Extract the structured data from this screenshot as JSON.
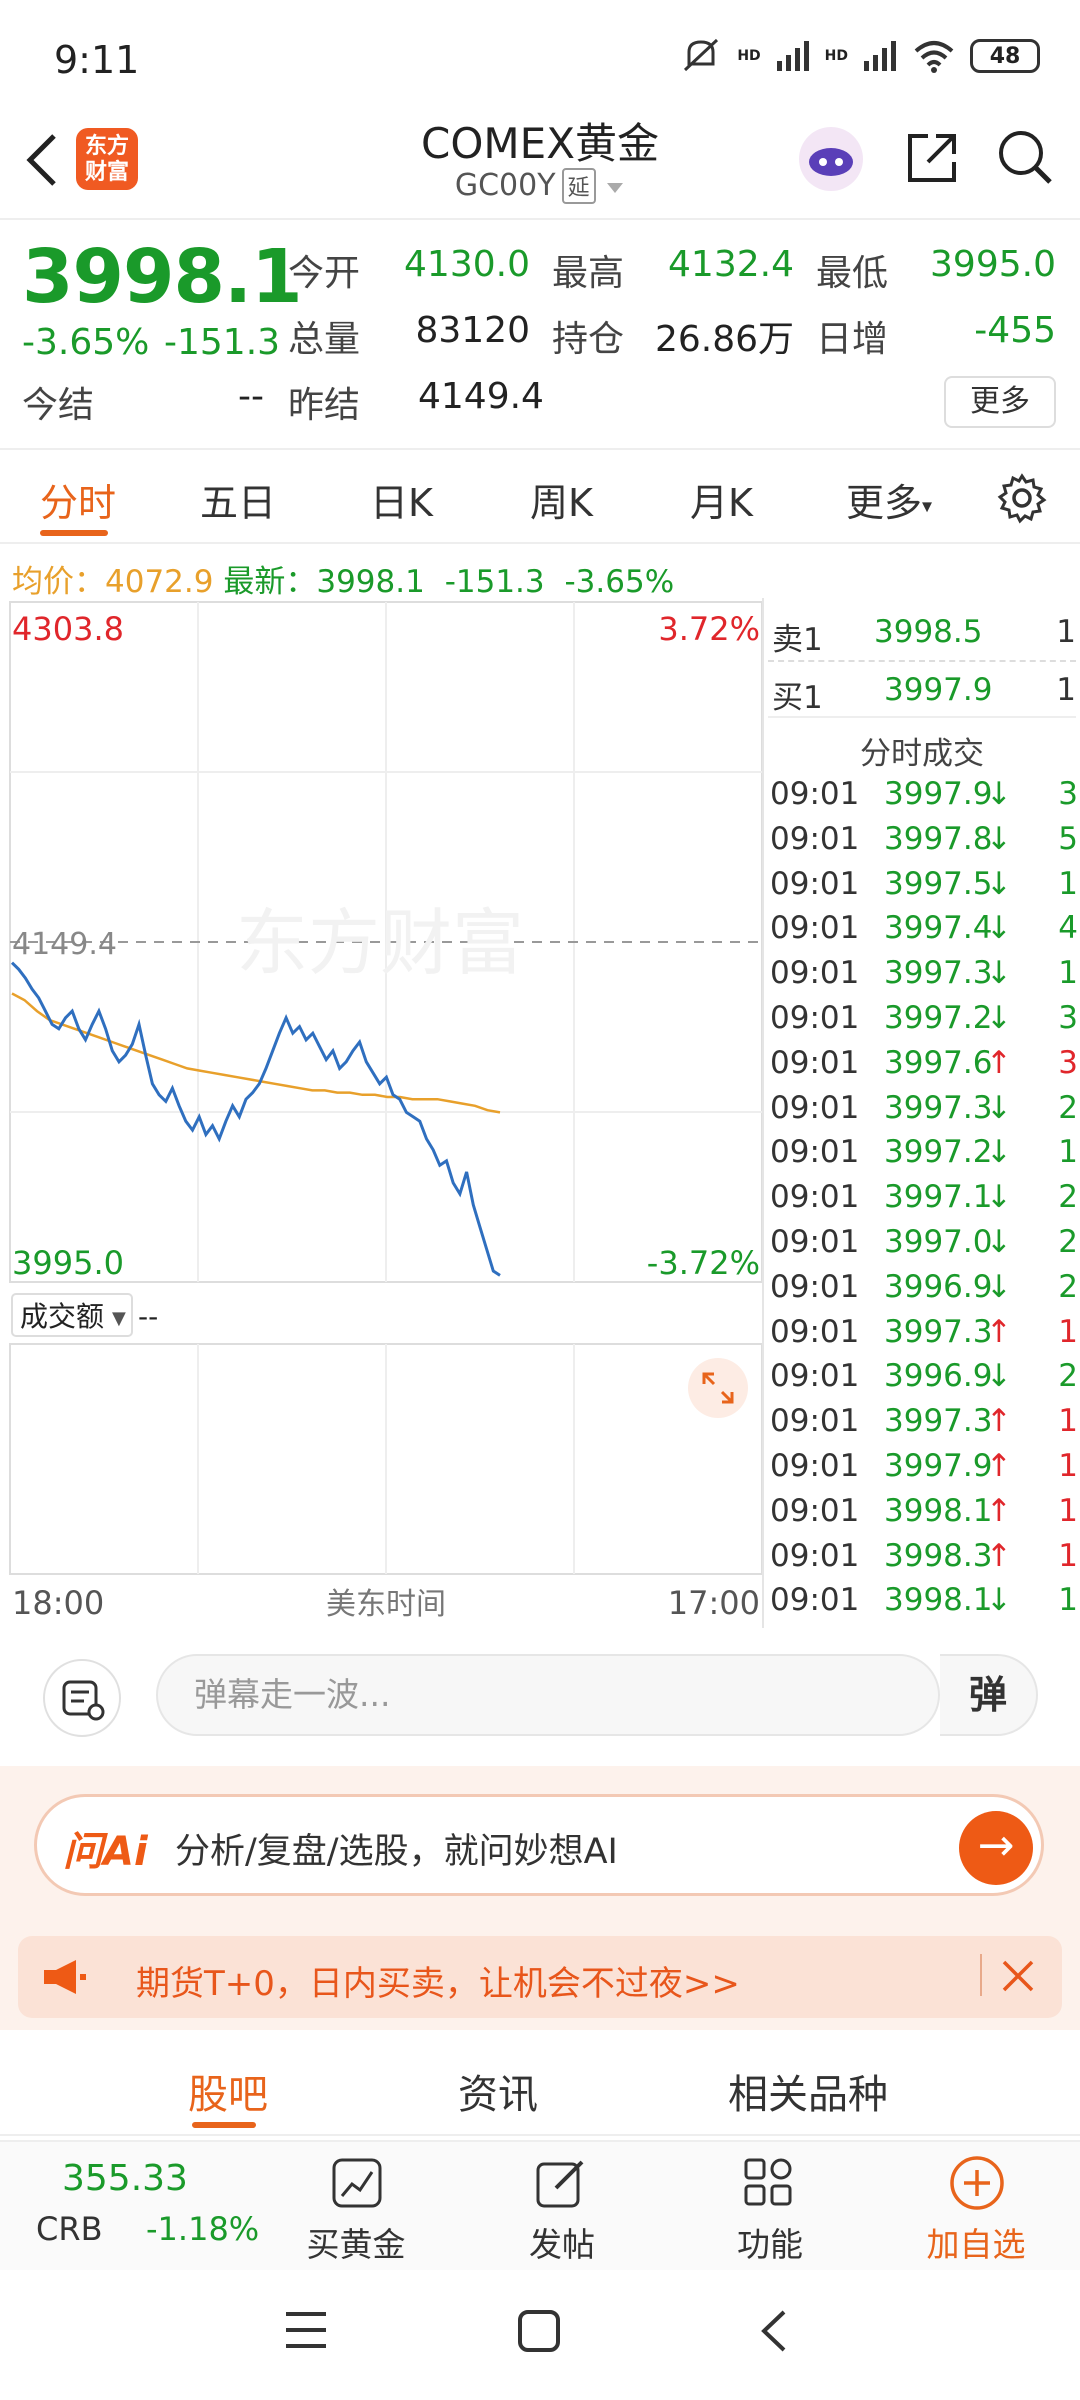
{
  "status_bar": {
    "time": "9:11",
    "battery": "48",
    "signal_label": "HD"
  },
  "header": {
    "logo_text": "东方财富",
    "title": "COMEX黄金",
    "subtitle": "GC00Y",
    "delay_tag": "延"
  },
  "quote": {
    "last_price": "3998.1",
    "change_pct": "-3.65%",
    "change": "-151.3",
    "fields": {
      "open_label": "今开",
      "open": "4130.0",
      "high_label": "最高",
      "high": "4132.4",
      "low_label": "最低",
      "low": "3995.0",
      "volume_label": "总量",
      "volume": "83120",
      "oi_label": "持仓",
      "oi": "26.86万",
      "daily_inc_label": "日增",
      "daily_inc": "-455",
      "settle_label": "今结",
      "settle": "--",
      "prev_settle_label": "昨结",
      "prev_settle": "4149.4"
    },
    "more_label": "更多"
  },
  "tabs": {
    "items": [
      "分时",
      "五日",
      "日K",
      "周K",
      "月K",
      "更多"
    ],
    "active": 0
  },
  "avg_row": {
    "avg_label": "均价：",
    "avg_value": "4072.9",
    "latest_label": "最新：",
    "latest_value": "3998.1",
    "change": "-151.3",
    "change_pct": "-3.65%"
  },
  "chart": {
    "top_price": "4303.8",
    "top_pct": "3.72%",
    "mid_price": "4149.4",
    "bottom_price": "3995.0",
    "bottom_pct": "-3.72%",
    "watermark": "东方财富",
    "volume_label": "成交额",
    "volume_value": "--",
    "x_start": "18:00",
    "x_mid": "美东时间",
    "x_end": "17:00",
    "colors": {
      "price": "#2f6fbf",
      "avg": "#e8a02b"
    }
  },
  "chart_data": {
    "type": "line",
    "title": "",
    "xlabel": "美东时间",
    "ylabel": "",
    "ylim": [
      3995.0,
      4303.8
    ],
    "reference": 4149.4,
    "series": [
      {
        "name": "",
        "values": [
          4140,
          4137,
          4133,
          4128,
          4124,
          4118,
          4112,
          4110,
          4115,
          4118,
          4110,
          4105,
          4112,
          4118,
          4110,
          4100,
          4095,
          4098,
          4103,
          4112,
          4098,
          4085,
          4080,
          4077,
          4083,
          4075,
          4068,
          4064,
          4070,
          4062,
          4066,
          4060,
          4068,
          4075,
          4070,
          4078,
          4081,
          4085,
          4092,
          4100,
          4108,
          4115,
          4108,
          4111,
          4105,
          4108,
          4102,
          4096,
          4100,
          4092,
          4095,
          4100,
          4104,
          4095,
          4090,
          4085,
          4088,
          4080,
          4078,
          4072,
          4070,
          4068,
          4060,
          4055,
          4048,
          4050,
          4040,
          4035,
          4045,
          4030,
          4020,
          4010,
          4000,
          3998
        ]
      },
      {
        "name": "",
        "values": [
          4126,
          4123,
          4118,
          4114,
          4112,
          4110,
          4108,
          4106,
          4104,
          4102,
          4100,
          4098,
          4096,
          4094,
          4092,
          4091,
          4090,
          4089,
          4088,
          4087,
          4086,
          4085,
          4084,
          4083,
          4082,
          4082,
          4081,
          4081,
          4080,
          4080,
          4079,
          4079,
          4078,
          4078,
          4078,
          4077,
          4076,
          4075,
          4073,
          4072
        ]
      }
    ]
  },
  "orderbook": {
    "ask_label": "卖1",
    "ask_price": "3998.5",
    "ask_qty": "1",
    "bid_label": "买1",
    "bid_price": "3997.9",
    "bid_qty": "1",
    "ticks_title": "分时成交",
    "ticks": [
      {
        "time": "09:01",
        "price": "3997.9",
        "dir": "down",
        "qty": "3"
      },
      {
        "time": "09:01",
        "price": "3997.8",
        "dir": "down",
        "qty": "5"
      },
      {
        "time": "09:01",
        "price": "3997.5",
        "dir": "down",
        "qty": "1"
      },
      {
        "time": "09:01",
        "price": "3997.4",
        "dir": "down",
        "qty": "4"
      },
      {
        "time": "09:01",
        "price": "3997.3",
        "dir": "down",
        "qty": "1"
      },
      {
        "time": "09:01",
        "price": "3997.2",
        "dir": "down",
        "qty": "3"
      },
      {
        "time": "09:01",
        "price": "3997.6",
        "dir": "up",
        "qty": "3"
      },
      {
        "time": "09:01",
        "price": "3997.3",
        "dir": "down",
        "qty": "2"
      },
      {
        "time": "09:01",
        "price": "3997.2",
        "dir": "down",
        "qty": "1"
      },
      {
        "time": "09:01",
        "price": "3997.1",
        "dir": "down",
        "qty": "2"
      },
      {
        "time": "09:01",
        "price": "3997.0",
        "dir": "down",
        "qty": "2"
      },
      {
        "time": "09:01",
        "price": "3996.9",
        "dir": "down",
        "qty": "2"
      },
      {
        "time": "09:01",
        "price": "3997.3",
        "dir": "up",
        "qty": "1"
      },
      {
        "time": "09:01",
        "price": "3996.9",
        "dir": "down",
        "qty": "2"
      },
      {
        "time": "09:01",
        "price": "3997.3",
        "dir": "up",
        "qty": "1"
      },
      {
        "time": "09:01",
        "price": "3997.9",
        "dir": "up",
        "qty": "1"
      },
      {
        "time": "09:01",
        "price": "3998.1",
        "dir": "up",
        "qty": "1"
      },
      {
        "time": "09:01",
        "price": "3998.3",
        "dir": "up",
        "qty": "1"
      },
      {
        "time": "09:01",
        "price": "3998.1",
        "dir": "down",
        "qty": "1"
      }
    ]
  },
  "danmaku": {
    "placeholder": "弹幕走一波...",
    "button_label": "弹"
  },
  "ai": {
    "logo": "问Ai",
    "prompt": "分析/复盘/选股，就问妙想AI",
    "send_icon": "→"
  },
  "promo": {
    "text": "期货T+0，日内买卖，让机会不过夜>>"
  },
  "bottom_tabs": {
    "items": [
      "股吧",
      "资讯",
      "相关品种"
    ],
    "active": 0
  },
  "toolbar": {
    "index_value": "355.33",
    "index_name": "CRB",
    "index_change": "-1.18%",
    "buy_gold": "买黄金",
    "post": "发帖",
    "functions": "功能",
    "add_watch": "加自选"
  }
}
